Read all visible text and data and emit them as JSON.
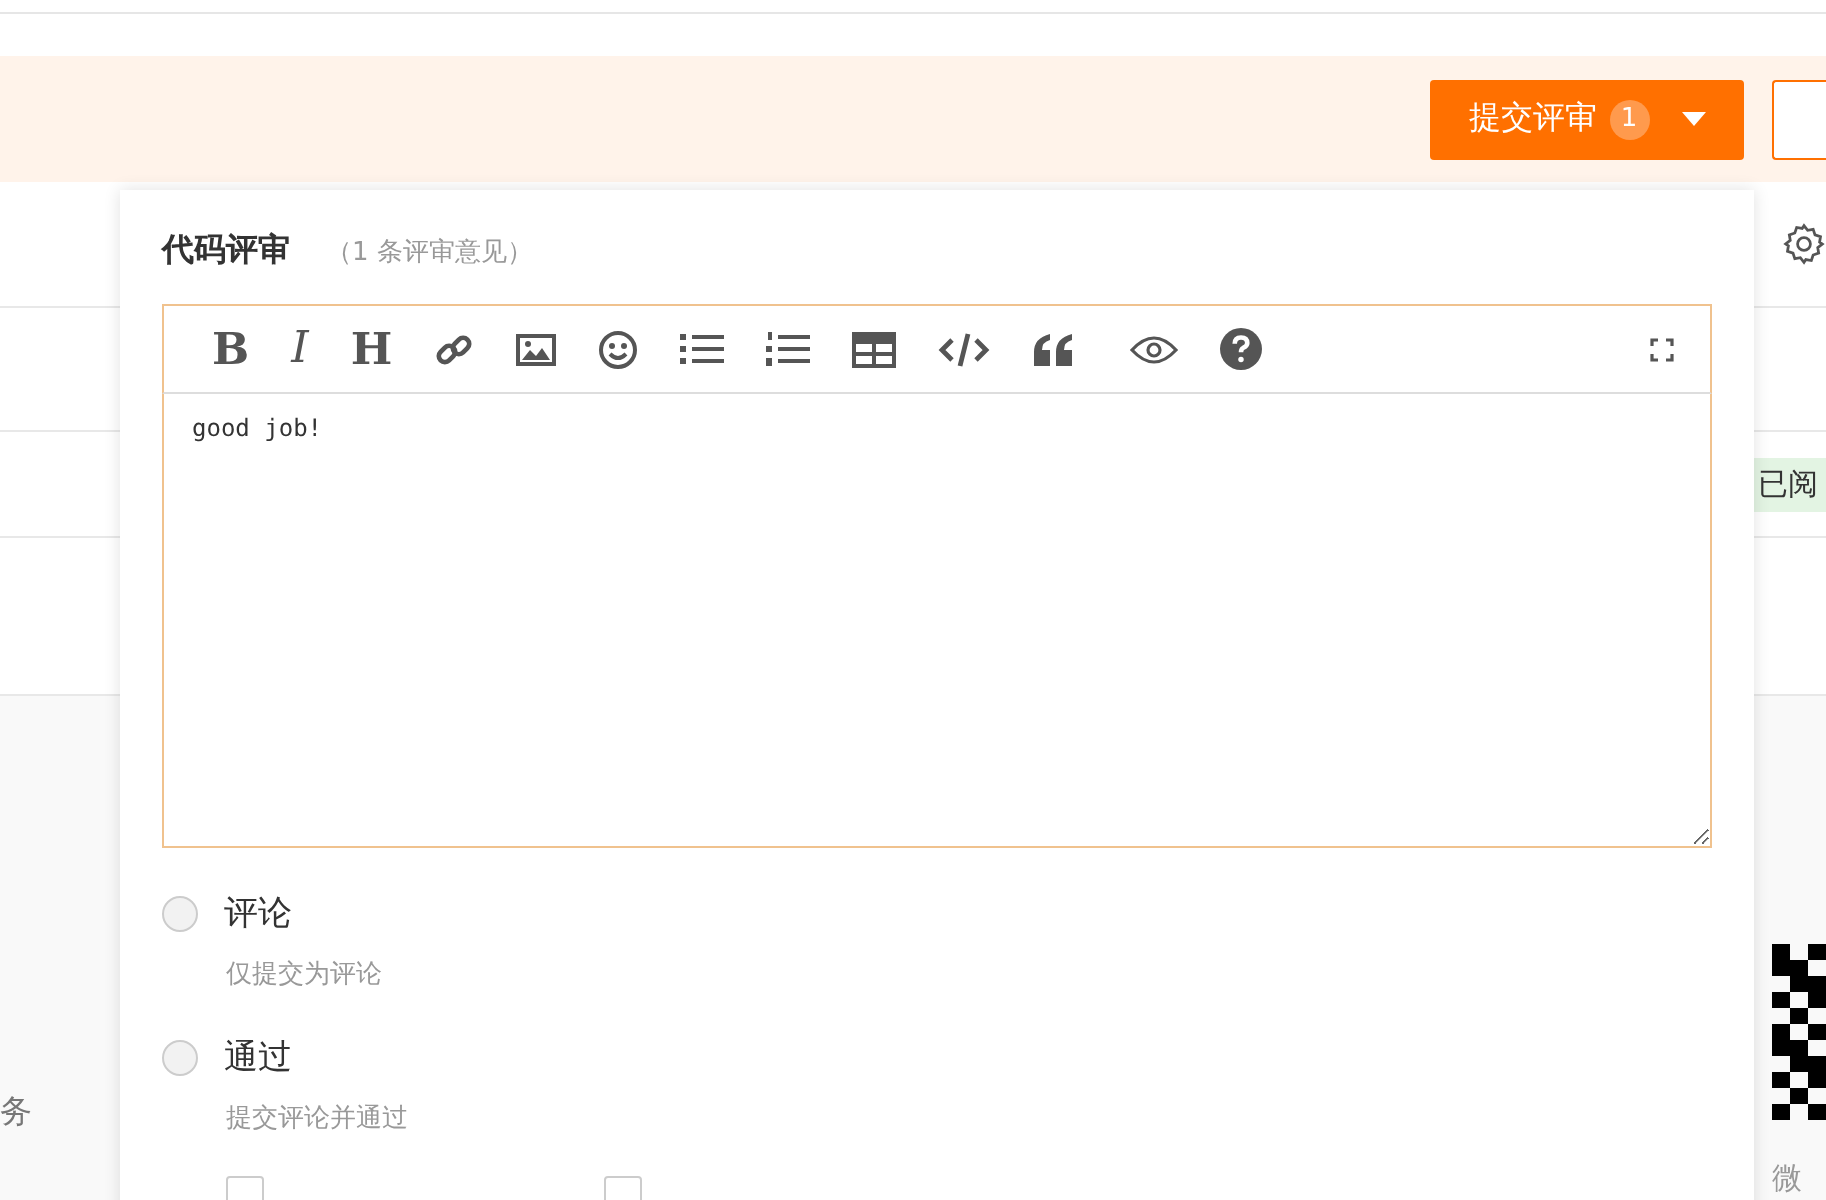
{
  "submit_button": {
    "label": "提交评审",
    "count": "1"
  },
  "background": {
    "side_label": "务",
    "tag": "已阅",
    "qr_caption": "微"
  },
  "review_panel": {
    "title": "代码评审",
    "subtitle": "（1 条评审意见）",
    "format_glyphs": [
      "B",
      "I",
      "H"
    ],
    "editor": {
      "value": "good job!"
    },
    "options": [
      {
        "label": "评论",
        "description": "仅提交为评论",
        "selected": false
      },
      {
        "label": "通过",
        "description": "提交评论并通过",
        "selected": false
      }
    ],
    "checks": [
      {
        "checked": false
      },
      {
        "checked": false
      }
    ]
  }
}
